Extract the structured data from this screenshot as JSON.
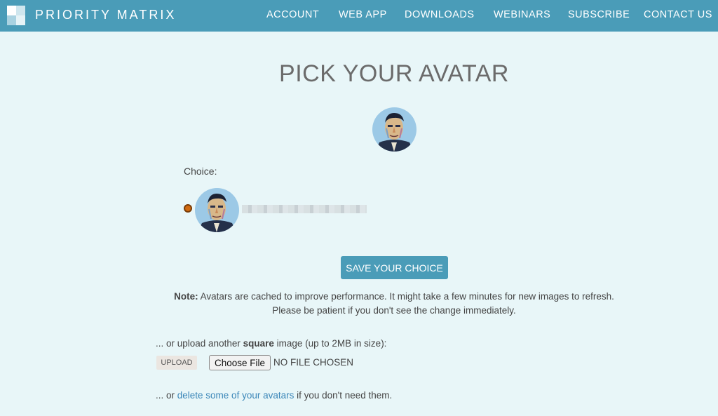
{
  "header": {
    "brand": "PRIORITY MATRIX",
    "nav": [
      "ACCOUNT",
      "WEB APP",
      "DOWNLOADS",
      "WEBINARS",
      "SUBSCRIBE",
      "CONTACT US"
    ]
  },
  "main": {
    "title": "PICK YOUR AVATAR",
    "choice_label": "Choice:",
    "save_button": "SAVE YOUR CHOICE",
    "note_bold": "Note:",
    "note_line1": " Avatars are cached to improve performance. It might take a few minutes for new images to refresh.",
    "note_line2": "Please be patient if you don't see the change immediately.",
    "upload_prefix": "... or upload another ",
    "upload_bold": "square",
    "upload_suffix": " image (up to 2MB in size):",
    "upload_badge": "UPLOAD",
    "choose_file": "Choose File",
    "no_file": "NO FILE CHOSEN",
    "delete_prefix": "... or ",
    "delete_link": "delete some of your avatars",
    "delete_suffix": " if you don't need them."
  },
  "colors": {
    "header_bg": "#4a9cb8",
    "page_bg": "#e8f6f8",
    "button_bg": "#4a9cb8",
    "link": "#3a86b8",
    "radio_selected": "#d06a10"
  },
  "icons": {
    "logo": "priority-matrix-logo",
    "avatar": "portrait-avatar"
  }
}
